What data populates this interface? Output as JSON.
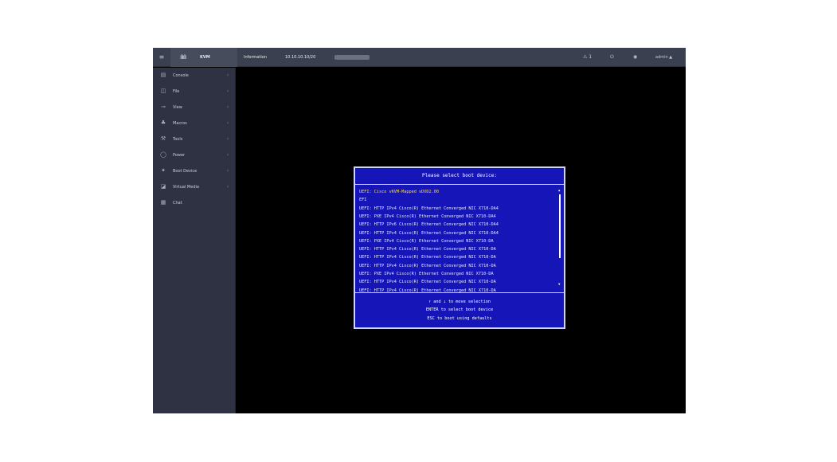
{
  "header": {
    "menu_icon": "≡",
    "brand_name": "KVM",
    "logo_text": "ılıılı",
    "info_1": "Information",
    "info_2": "10.10.10.10/20",
    "alerts": "⚠ 1",
    "user": "admin ▲"
  },
  "sidebar": {
    "items": [
      {
        "label": "Console",
        "icon": "▤"
      },
      {
        "label": "File",
        "icon": "◫"
      },
      {
        "label": "View",
        "icon": "⊸"
      },
      {
        "label": "Macros",
        "icon": "♣"
      },
      {
        "label": "Tools",
        "icon": "⚒"
      },
      {
        "label": "Power",
        "icon": "◯"
      },
      {
        "label": "Boot Device",
        "icon": "✦"
      },
      {
        "label": "Virtual Media",
        "icon": "◪"
      },
      {
        "label": "Chat",
        "icon": "▦"
      }
    ]
  },
  "boot_menu": {
    "title": "Please select boot device:",
    "devices": [
      "UEFI: Cisco vKVM-Mapped vDVD2.00",
      "EFI",
      "UEFI: HTTP IPv4 Cisco(R) Ethernet Converged NIC X710-DA4",
      "UEFI: PXE IPv4 Cisco(R) Ethernet Converged NIC X710-DA4",
      "UEFI: HTTP IPv6 Cisco(R) Ethernet Converged NIC X710-DA4",
      "UEFI: HTTP IPv4 Cisco(R) Ethernet Converged NIC X710-DA4",
      "UEFI: PXE IPv4 Cisco(R) Ethernet Converged NIC X710-DA",
      "UEFI: HTTP IPv4 Cisco(R) Ethernet Converged NIC X710-DA",
      "UEFI: HTTP IPv4 Cisco(R) Ethernet Converged NIC X710-DA",
      "UEFI: HTTP IPv4 Cisco(R) Ethernet Converged NIC X710-DA",
      "UEFI: PXE IPv4 Cisco(R) Ethernet Converged NIC X710-DA",
      "UEFI: HTTP IPv4 Cisco(R) Ethernet Converged NIC X710-DA",
      "UEFI: HTTP IPv4 Cisco(R) Ethernet Converged NIC X710-DA"
    ],
    "selected_index": 0,
    "help_1": "↑ and ↓ to move selection",
    "help_2": "ENTER to select boot device",
    "help_3": "ESC to boot using defaults"
  }
}
